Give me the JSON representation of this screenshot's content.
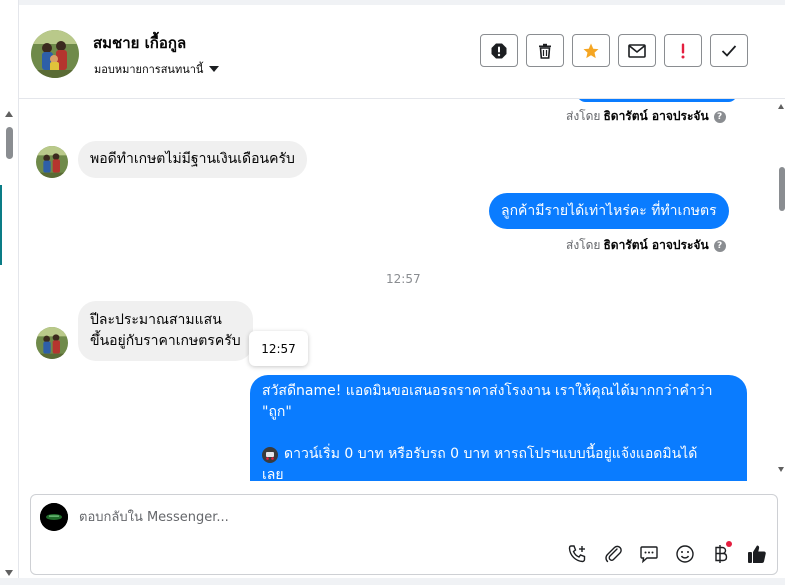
{
  "header": {
    "contact_name": "สมชาย เกื้อกูล",
    "assign_label": "มอบหมายการสนทนานี้",
    "toolbar": [
      {
        "name": "spam-button",
        "icon": "alert-octagon-icon"
      },
      {
        "name": "delete-button",
        "icon": "trash-icon"
      },
      {
        "name": "star-button",
        "icon": "star-icon"
      },
      {
        "name": "mark-unread-button",
        "icon": "envelope-icon"
      },
      {
        "name": "follow-up-button",
        "icon": "exclamation-icon"
      },
      {
        "name": "mark-done-button",
        "icon": "check-icon"
      }
    ]
  },
  "thread": {
    "messages": [
      {
        "direction": "out",
        "sent_by_prefix": "ส่งโดย",
        "sent_by_name": "ธิดารัตน์ อาจประจัน"
      },
      {
        "direction": "in",
        "text": "พอดีทำเกษตไม่มีฐานเงินเดือนครับ"
      },
      {
        "direction": "out",
        "text": "ลูกค้ามีรายได้เท่าไหร่คะ ที่ทำเกษตร",
        "sent_by_prefix": "ส่งโดย",
        "sent_by_name": "ธิดารัตน์ อาจประจัน"
      },
      {
        "direction": "separator",
        "time": "12:57"
      },
      {
        "direction": "in",
        "lines": [
          "ปีละประมาณสามแสน",
          "ขึ้นอยู่กับราคาเกษตรครับ"
        ]
      },
      {
        "direction": "out",
        "lines": [
          "สวัสดีname! แอดมินขอเสนอรถราคาส่งโรงงาน เราให้คุณได้มากกว่าคำว่า",
          "\"ถูก\"",
          "",
          "ดาวน์เริ่ม 0 บาท หรือรับรถ 0 บาท หารถโปรฯแบบนี้อยู่แจ้งแอดมินได้",
          "เลย"
        ]
      }
    ],
    "tooltip_time": "12:57"
  },
  "composer": {
    "placeholder": "ตอบกลับใน Messenger...",
    "tools": [
      "call-plus-icon",
      "paperclip-icon",
      "chat-dots-icon",
      "smiley-icon",
      "baht-icon",
      "thumbs-up-icon"
    ]
  },
  "colors": {
    "accent": "#0a7cff",
    "incoming_bubble": "#f0f0f0",
    "star": "#f5a623",
    "exclamation": "#e41e3f",
    "notification_dot": "#e41e3f"
  }
}
